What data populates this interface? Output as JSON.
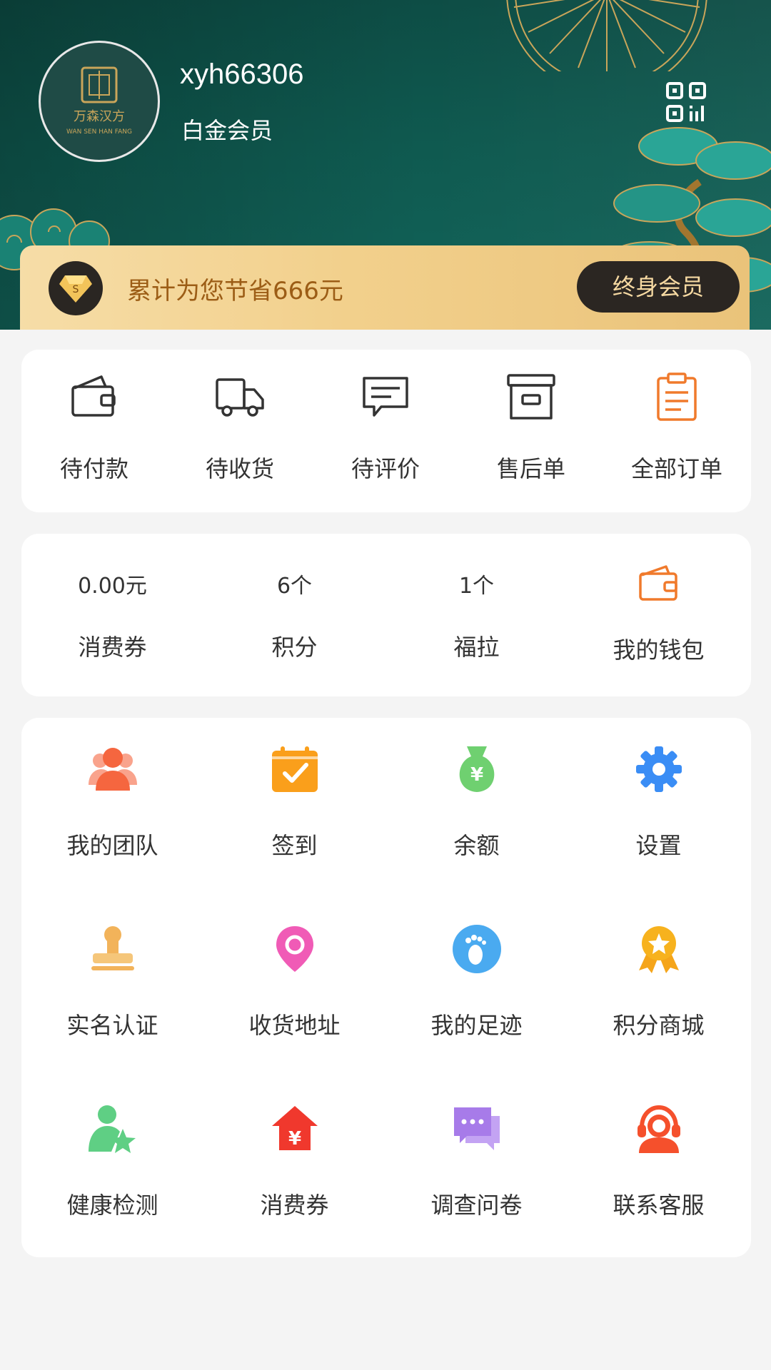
{
  "header": {
    "username": "xyh66306",
    "member_level": "白金会员",
    "brand_logo_text": "万森汉方",
    "brand_logo_subtext": "WAN SEN HAN FANG"
  },
  "savings": {
    "text": "累计为您节省666元",
    "button_label": "终身会员"
  },
  "orders": [
    {
      "label": "待付款",
      "icon": "wallet-icon"
    },
    {
      "label": "待收货",
      "icon": "truck-icon"
    },
    {
      "label": "待评价",
      "icon": "comment-icon"
    },
    {
      "label": "售后单",
      "icon": "archive-box-icon"
    },
    {
      "label": "全部订单",
      "icon": "clipboard-icon"
    }
  ],
  "assets": [
    {
      "value": "0.00元",
      "label": "消费券"
    },
    {
      "value": "6个",
      "label": "积分"
    },
    {
      "value": "1个",
      "label": "福拉"
    },
    {
      "label": "我的钱包",
      "icon": "wallet-icon"
    }
  ],
  "services": [
    {
      "label": "我的团队",
      "icon": "team-icon"
    },
    {
      "label": "签到",
      "icon": "calendar-check-icon"
    },
    {
      "label": "余额",
      "icon": "money-bag-icon"
    },
    {
      "label": "设置",
      "icon": "gear-icon"
    },
    {
      "label": "实名认证",
      "icon": "stamp-icon"
    },
    {
      "label": "收货地址",
      "icon": "location-pin-icon"
    },
    {
      "label": "我的足迹",
      "icon": "footprint-icon"
    },
    {
      "label": "积分商城",
      "icon": "medal-icon"
    },
    {
      "label": "健康检测",
      "icon": "user-star-icon"
    },
    {
      "label": "消费券",
      "icon": "coupon-house-icon"
    },
    {
      "label": "调查问卷",
      "icon": "chat-bubbles-icon"
    },
    {
      "label": "联系客服",
      "icon": "customer-service-icon"
    }
  ],
  "colors": {
    "header_bg": "#0f5a50",
    "gold": "#f2d08c",
    "accent_orange": "#f07a2c",
    "button_dark": "#2b2622"
  }
}
